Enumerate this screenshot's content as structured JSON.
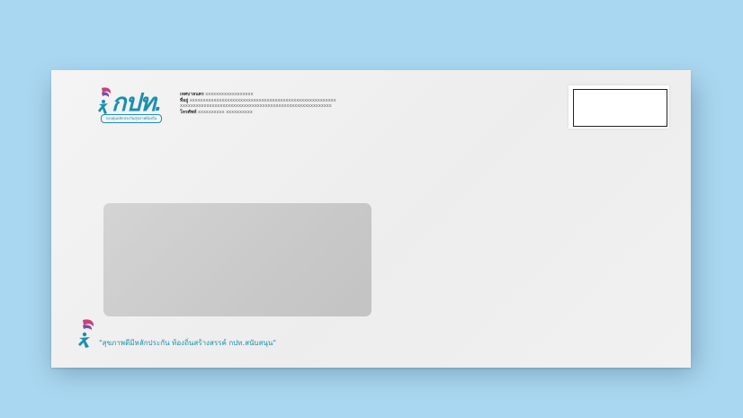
{
  "logo": {
    "text": "กปท.",
    "subtitle": "กองทุนหลักประกันสุขภาพท้องถิ่น"
  },
  "sender": {
    "name_label": "เทศบาลนคร",
    "name_value": "xxxxxxxxxxxxxxxxxx",
    "address_label": "ที่อยู่",
    "address_line1": "xxxxxxxxxxxxxxxxxxxxxxxxxxxxxxxxxxxxxxxxxxxxxxxxxxxxxxx",
    "address_line2": "xxxxxxxxxxxxxxxxxxxxxxxxxxxxxxxxxxxxxxxxxxxxxxxxxxxxxxxxx",
    "phone_label": "โทรศัพท์",
    "phone_value": "xxxxxxxxxx  xxxxxxxxxx"
  },
  "slogan": "\"สุขภาพดีมีหลักประกัน ท้องถิ่นสร้างสรรค์ กปท.สนับสนุน\"",
  "colors": {
    "background": "#a9d6f0",
    "envelope": "#f1f1f1",
    "brand": "#1c8fae",
    "accent": "#c8427b"
  }
}
